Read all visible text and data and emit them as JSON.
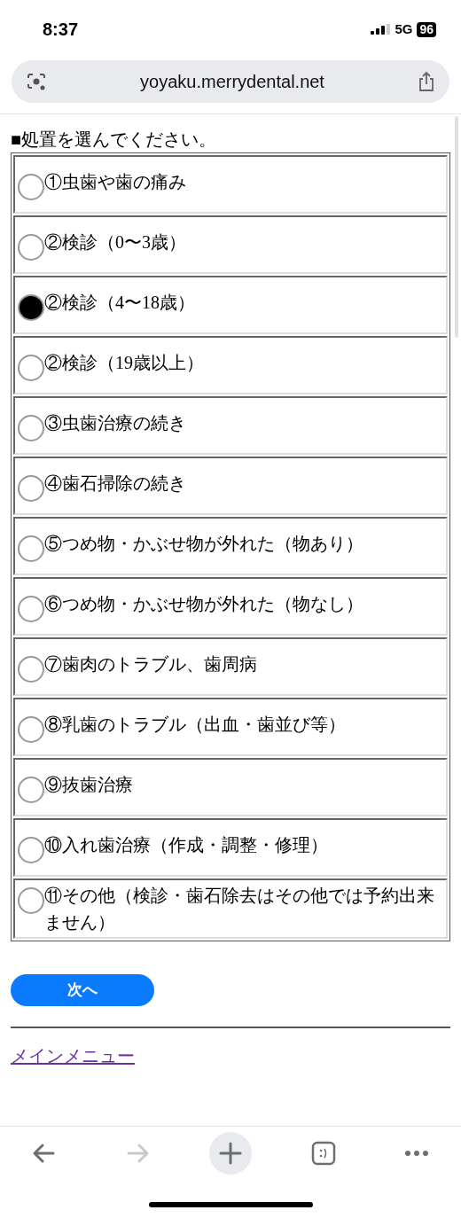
{
  "status_bar": {
    "time": "8:37",
    "network": "5G",
    "battery": "96"
  },
  "address_bar": {
    "url": "yoyaku.merrydental.net"
  },
  "heading": "■処置を選んでください。",
  "options": [
    {
      "label": "①虫歯や歯の痛み",
      "selected": false
    },
    {
      "label": "②検診（0〜3歳）",
      "selected": false
    },
    {
      "label": "②検診（4〜18歳）",
      "selected": true
    },
    {
      "label": "②検診（19歳以上）",
      "selected": false
    },
    {
      "label": "③虫歯治療の続き",
      "selected": false
    },
    {
      "label": "④歯石掃除の続き",
      "selected": false
    },
    {
      "label": "⑤つめ物・かぶせ物が外れた（物あり）",
      "selected": false
    },
    {
      "label": "⑥つめ物・かぶせ物が外れた（物なし）",
      "selected": false
    },
    {
      "label": "⑦歯肉のトラブル、歯周病",
      "selected": false
    },
    {
      "label": "⑧乳歯のトラブル（出血・歯並び等）",
      "selected": false
    },
    {
      "label": "⑨抜歯治療",
      "selected": false
    },
    {
      "label": "⑩入れ歯治療（作成・調整・修理）",
      "selected": false
    },
    {
      "label": "⑪その他（検診・歯石除去はその他では予約出来ません）",
      "selected": false
    }
  ],
  "next_button": "次へ",
  "menu_link": "メインメニュー",
  "toolbar": [
    {
      "kind": "back",
      "disabled": false
    },
    {
      "kind": "forward",
      "disabled": true
    },
    {
      "kind": "new_tab",
      "disabled": false
    },
    {
      "kind": "tabs",
      "disabled": false
    },
    {
      "kind": "more",
      "disabled": false
    }
  ]
}
